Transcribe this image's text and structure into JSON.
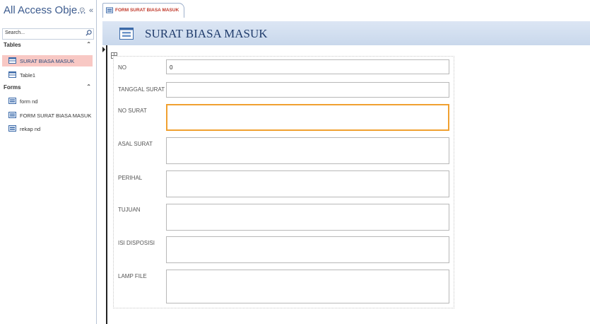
{
  "nav": {
    "title": "All Access Obje...",
    "options_icon": "chevron-circle-icon",
    "collapse_label": "«",
    "search_placeholder": "Search...",
    "groups": [
      {
        "label": "Tables",
        "chevron": "«",
        "items": [
          {
            "label": "SURAT BIASA MASUK",
            "icon": "table-icon",
            "selected": true
          },
          {
            "label": "Table1",
            "icon": "table-icon",
            "selected": false
          }
        ]
      },
      {
        "label": "Forms",
        "chevron": "«",
        "items": [
          {
            "label": "form nd",
            "icon": "form-icon",
            "selected": false
          },
          {
            "label": "FORM SURAT BIASA MASUK",
            "icon": "form-icon",
            "selected": false
          },
          {
            "label": "rekap nd",
            "icon": "form-icon",
            "selected": false
          }
        ]
      }
    ]
  },
  "document": {
    "tab_label": "FORM SURAT BIASA MASUK",
    "header_title": "SURAT BIASA MASUK"
  },
  "form": {
    "fields": [
      {
        "label": "NO",
        "value": "0"
      },
      {
        "label": "TANGGAL SURAT",
        "value": ""
      },
      {
        "label": "NO SURAT",
        "value": ""
      },
      {
        "label": "ASAL SURAT",
        "value": ""
      },
      {
        "label": "PERIHAL",
        "value": ""
      },
      {
        "label": "TUJUAN",
        "value": ""
      },
      {
        "label": "ISI DISPOSISI",
        "value": ""
      },
      {
        "label": "LAMP FILE",
        "value": ""
      }
    ]
  },
  "colors": {
    "selected_item": "#f8c8c4",
    "tab_text": "#c0392b",
    "header_bg": "#c9d8ec",
    "focus_border": "#f0a030"
  }
}
